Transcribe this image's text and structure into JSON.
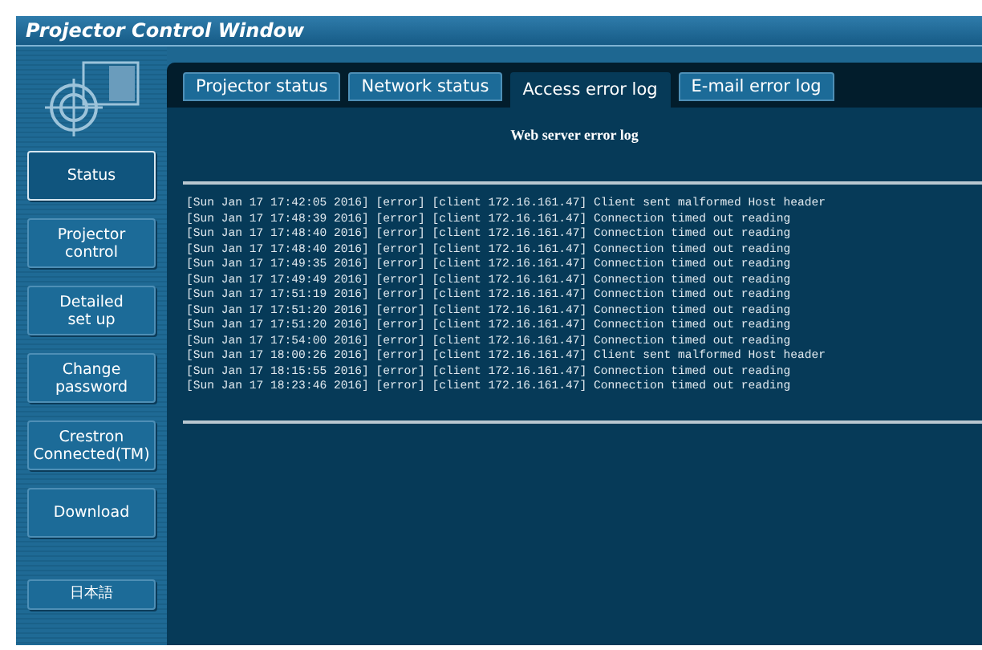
{
  "window": {
    "title": "Projector Control Window"
  },
  "sidebar": {
    "items": [
      {
        "label": "Status",
        "selected": true
      },
      {
        "label": "Projector\ncontrol",
        "selected": false
      },
      {
        "label": "Detailed\nset up",
        "selected": false
      },
      {
        "label": "Change\npassword",
        "selected": false
      },
      {
        "label": "Crestron\nConnected(TM)",
        "selected": false
      },
      {
        "label": "Download",
        "selected": false
      }
    ],
    "language_button": "日本語"
  },
  "tabs": [
    {
      "label": "Projector status",
      "selected": false
    },
    {
      "label": "Network status",
      "selected": false
    },
    {
      "label": "Access error log",
      "selected": true
    },
    {
      "label": "E-mail error log",
      "selected": false
    }
  ],
  "panel": {
    "title": "Web server error log",
    "log_lines": [
      "[Sun Jan 17 17:42:05 2016] [error] [client 172.16.161.47] Client sent malformed Host header",
      "[Sun Jan 17 17:48:39 2016] [error] [client 172.16.161.47] Connection timed out reading",
      "[Sun Jan 17 17:48:40 2016] [error] [client 172.16.161.47] Connection timed out reading",
      "[Sun Jan 17 17:48:40 2016] [error] [client 172.16.161.47] Connection timed out reading",
      "[Sun Jan 17 17:49:35 2016] [error] [client 172.16.161.47] Connection timed out reading",
      "[Sun Jan 17 17:49:49 2016] [error] [client 172.16.161.47] Connection timed out reading",
      "[Sun Jan 17 17:51:19 2016] [error] [client 172.16.161.47] Connection timed out reading",
      "[Sun Jan 17 17:51:20 2016] [error] [client 172.16.161.47] Connection timed out reading",
      "[Sun Jan 17 17:51:20 2016] [error] [client 172.16.161.47] Connection timed out reading",
      "[Sun Jan 17 17:54:00 2016] [error] [client 172.16.161.47] Connection timed out reading",
      "[Sun Jan 17 18:00:26 2016] [error] [client 172.16.161.47] Client sent malformed Host header",
      "[Sun Jan 17 18:15:55 2016] [error] [client 172.16.161.47] Connection timed out reading",
      "[Sun Jan 17 18:23:46 2016] [error] [client 172.16.161.47] Connection timed out reading"
    ]
  }
}
